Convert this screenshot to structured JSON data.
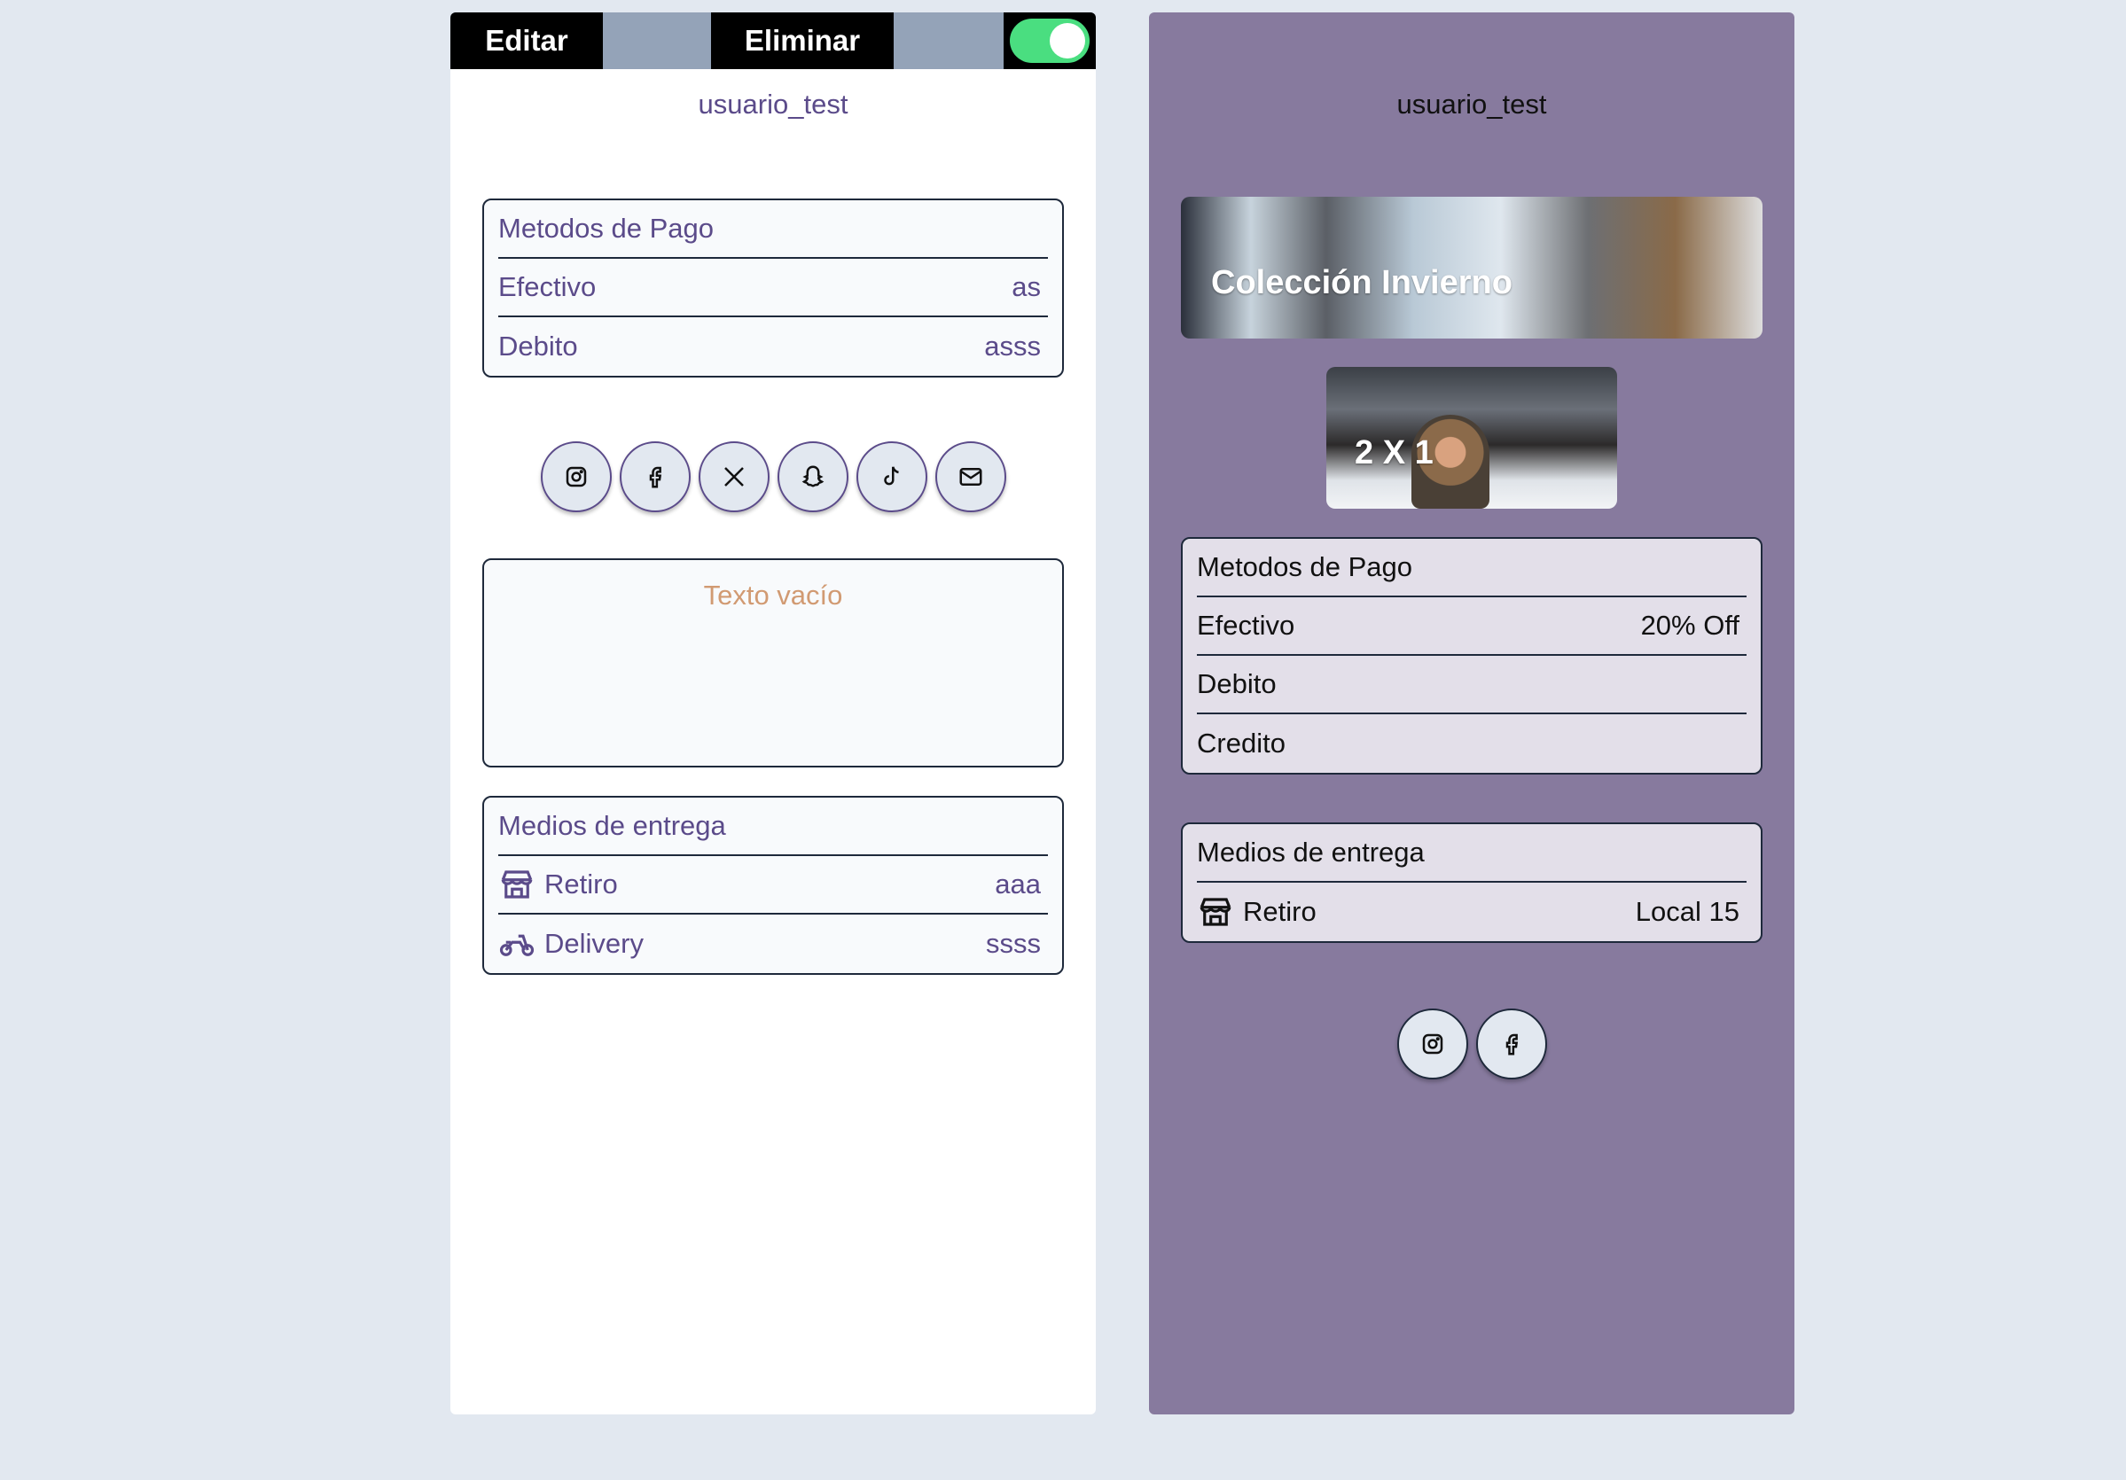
{
  "editor": {
    "toolbar": {
      "edit_label": "Editar",
      "delete_label": "Eliminar",
      "toggle_on": true
    },
    "username": "usuario_test",
    "payment": {
      "title": "Metodos de Pago",
      "items": [
        {
          "label": "Efectivo",
          "value": "as"
        },
        {
          "label": "Debito",
          "value": "asss"
        }
      ]
    },
    "socials": [
      "instagram-icon",
      "facebook-icon",
      "x-icon",
      "snapchat-icon",
      "tiktok-icon",
      "mail-icon"
    ],
    "text_placeholder": "Texto vacío",
    "delivery": {
      "title": "Medios de entrega",
      "items": [
        {
          "label": "Retiro",
          "value": "aaa",
          "icon": "store-icon"
        },
        {
          "label": "Delivery",
          "value": "ssss",
          "icon": "motorcycle-icon"
        }
      ]
    }
  },
  "preview": {
    "username": "usuario_test",
    "banners": [
      {
        "title": "Colección Invierno"
      },
      {
        "title": "2 X 1"
      }
    ],
    "payment": {
      "title": "Metodos de Pago",
      "items": [
        {
          "label": "Efectivo",
          "value": "20% Off"
        },
        {
          "label": "Debito",
          "value": ""
        },
        {
          "label": "Credito",
          "value": ""
        }
      ]
    },
    "delivery": {
      "title": "Medios de entrega",
      "items": [
        {
          "label": "Retiro",
          "value": "Local 15",
          "icon": "store-icon"
        }
      ]
    },
    "socials": [
      "instagram-icon",
      "facebook-icon"
    ]
  },
  "colors": {
    "page_bg": "#e2e8f0",
    "preview_bg": "#877a9e",
    "toggle_on": "#4ade80",
    "accent_text": "#5b4b8a",
    "placeholder_text": "#d19a72"
  }
}
